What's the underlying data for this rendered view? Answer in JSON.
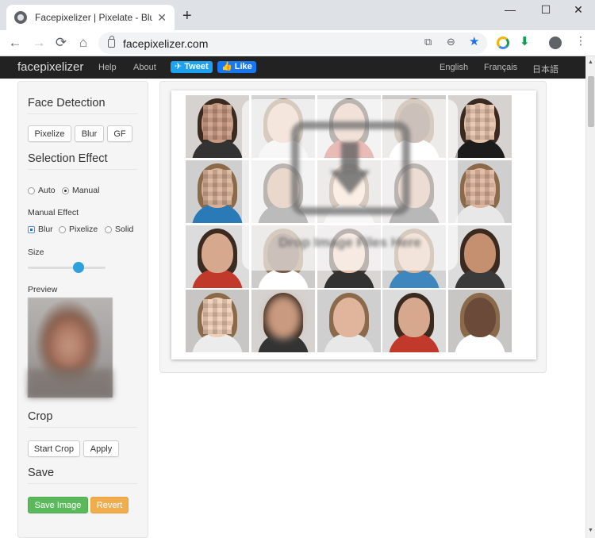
{
  "browser": {
    "tab_title": "Facepixelizer | Pixelate - Blur - A",
    "url": "facepixelizer.com",
    "new_tab": "+",
    "minimize": "—",
    "maximize": "☐",
    "close": "✕"
  },
  "sitenav": {
    "brand": "facepixelizer",
    "links": [
      "Help",
      "About"
    ],
    "tweet": "Tweet",
    "like": "Like",
    "languages": [
      "English",
      "Français",
      "日本語"
    ]
  },
  "panel": {
    "face_detection": "Face Detection",
    "detect_buttons": [
      "Pixelize",
      "Blur",
      "GF"
    ],
    "selection_effect": "Selection Effect",
    "mode_auto": "Auto",
    "mode_manual": "Manual",
    "mode_selected": "Manual",
    "manual_effect": "Manual Effect",
    "effect_blur": "Blur",
    "effect_pixelize": "Pixelize",
    "effect_solid": "Solid",
    "effect_selected": "Blur",
    "size": "Size",
    "size_value": 0.65,
    "preview": "Preview",
    "crop": "Crop",
    "start_crop": "Start Crop",
    "apply": "Apply",
    "save": "Save",
    "save_image": "Save Image",
    "revert": "Revert"
  },
  "main": {
    "drop_text": "Drop Image Files Here"
  },
  "colors": {
    "save_green": "#5cb85c",
    "revert_orange": "#f0ad4e",
    "slider_blue": "#2ea0dc",
    "nav_bg": "#222222",
    "tweet_blue": "#1da1f2",
    "like_blue": "#1877f2"
  }
}
